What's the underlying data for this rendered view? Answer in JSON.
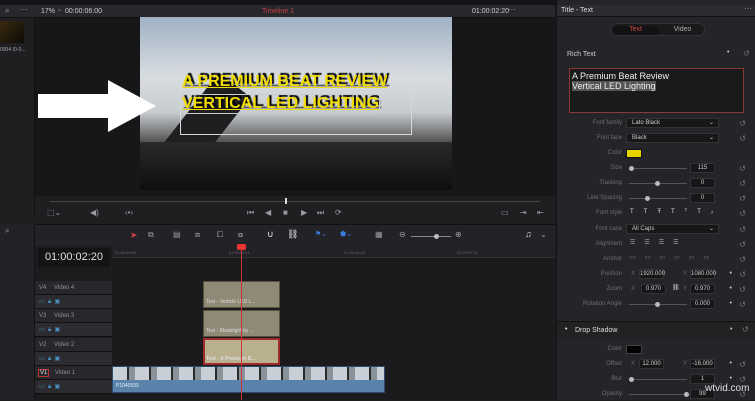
{
  "viewer": {
    "zoom": "17%",
    "duration": "00:00:06:00",
    "timeline_name": "Timeline 1",
    "timecode": "01:00:02:20",
    "title_line1": "A PREMIUM BEAT REVIEW",
    "title_line2": "VERTICAL LED LIGHTING"
  },
  "media_pool": {
    "clip_label": "0004 (0-0..."
  },
  "timeline": {
    "timecode": "01:00:02:20",
    "ruler": [
      "01:00:00:00",
      "01:00:02:11",
      "01:00:04:23",
      "01:00:07:11"
    ],
    "tracks": [
      {
        "id": "V4",
        "name": "Video 4"
      },
      {
        "id": "V3",
        "name": "Video 3"
      },
      {
        "id": "V2",
        "name": "Video 2"
      },
      {
        "id": "V1",
        "name": "Video 1"
      }
    ],
    "clips": {
      "v4": "Text - Verticle LED L...",
      "v3": "Text - Bladelight by ...",
      "v2": "Text - A Premium B...",
      "v1": "P1040599"
    }
  },
  "inspector": {
    "title": "Title - Text",
    "tabs": [
      "Text",
      "Video"
    ],
    "rich_text_label": "Rich Text",
    "rich_text_line1": "A Premium Beat Review",
    "rich_text_line2": "Vertical LED Lighting",
    "labels": {
      "font_family": "Font family",
      "font_face": "Font face",
      "color": "Color",
      "size": "Size",
      "tracking": "Tracking",
      "line_spacing": "Line Spacing",
      "font_style": "Font style",
      "font_case": "Font case",
      "alignment": "Alignment",
      "anchor": "Anchor",
      "position": "Position",
      "zoom": "Zoom",
      "rotation": "Rotation Angle",
      "x": "X",
      "y": "Y"
    },
    "values": {
      "font_family": "Lato Black",
      "font_face": "Black",
      "color": "#e8d400",
      "size": "115",
      "tracking": "0",
      "line_spacing": "0",
      "font_case": "All Caps",
      "position_x": "1920.000",
      "position_y": "1080.000",
      "zoom_x": "0.970",
      "zoom_y": "0.970",
      "rotation": "0.000"
    },
    "drop_shadow": {
      "header": "Drop Shadow",
      "color_label": "Color",
      "color": "#000000",
      "offset_label": "Offset",
      "offset_x": "12.000",
      "offset_y": "-16.000",
      "blur_label": "Blur",
      "blur": "1",
      "opacity_label": "Opacity",
      "opacity": "99"
    }
  },
  "watermark": "wtvid.com"
}
